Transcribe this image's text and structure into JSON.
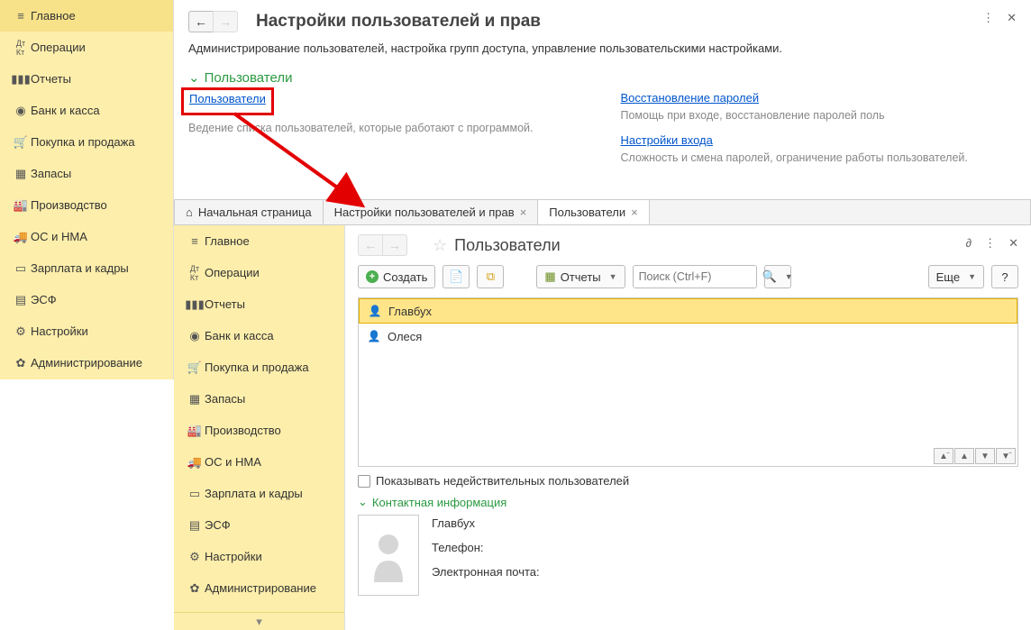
{
  "left_sidebar": {
    "items": [
      {
        "icon": "bars",
        "label": "Главное"
      },
      {
        "icon": "dr",
        "label": "Операции"
      },
      {
        "icon": "chart",
        "label": "Отчеты"
      },
      {
        "icon": "coin",
        "label": "Банк и касса"
      },
      {
        "icon": "cart",
        "label": "Покупка и продажа"
      },
      {
        "icon": "box",
        "label": "Запасы"
      },
      {
        "icon": "factory",
        "label": "Производство"
      },
      {
        "icon": "truck",
        "label": "ОС и НМА"
      },
      {
        "icon": "wallet",
        "label": "Зарплата и кадры"
      },
      {
        "icon": "doc",
        "label": "ЭСФ"
      },
      {
        "icon": "sliders",
        "label": "Настройки"
      },
      {
        "icon": "gear",
        "label": "Администрирование"
      }
    ]
  },
  "top": {
    "title": "Настройки пользователей и прав",
    "subtitle": "Администрирование пользователей, настройка групп доступа, управление пользовательскими настройками.",
    "section": "Пользователи",
    "col1_link": "Пользователи",
    "col1_desc": "Ведение списка пользователей, которые работают с программой.",
    "col2_link1": "Восстановление паролей",
    "col2_desc1": "Помощь при входе, восстановление паролей поль",
    "col2_link2": "Настройки входа",
    "col2_desc2": "Сложность и смена паролей, ограничение работы пользователей."
  },
  "tabs": [
    {
      "label": "Начальная страница",
      "closable": false,
      "icon": "home"
    },
    {
      "label": "Настройки пользователей и прав",
      "closable": true
    },
    {
      "label": "Пользователи",
      "closable": true,
      "active": true
    }
  ],
  "sidebar2": {
    "items": [
      {
        "icon": "bars",
        "label": "Главное"
      },
      {
        "icon": "dr",
        "label": "Операции"
      },
      {
        "icon": "chart",
        "label": "Отчеты"
      },
      {
        "icon": "coin",
        "label": "Банк и касса"
      },
      {
        "icon": "cart",
        "label": "Покупка и продажа"
      },
      {
        "icon": "box",
        "label": "Запасы"
      },
      {
        "icon": "factory",
        "label": "Производство"
      },
      {
        "icon": "truck",
        "label": "ОС и НМА"
      },
      {
        "icon": "wallet",
        "label": "Зарплата и кадры"
      },
      {
        "icon": "doc",
        "label": "ЭСФ"
      },
      {
        "icon": "sliders",
        "label": "Настройки"
      },
      {
        "icon": "gear",
        "label": "Администрирование"
      }
    ]
  },
  "content": {
    "title": "Пользователи",
    "create_label": "Создать",
    "reports_label": "Отчеты",
    "search_placeholder": "Поиск (Ctrl+F)",
    "more_label": "Еще",
    "users": [
      {
        "name": "Главбух",
        "selected": true
      },
      {
        "name": "Олеся",
        "selected": false
      }
    ],
    "checkbox_label": "Показывать недействительных пользователей",
    "contact_header": "Контактная информация",
    "contact_name": "Главбух",
    "phone_label": "Телефон:",
    "email_label": "Электронная почта:"
  }
}
